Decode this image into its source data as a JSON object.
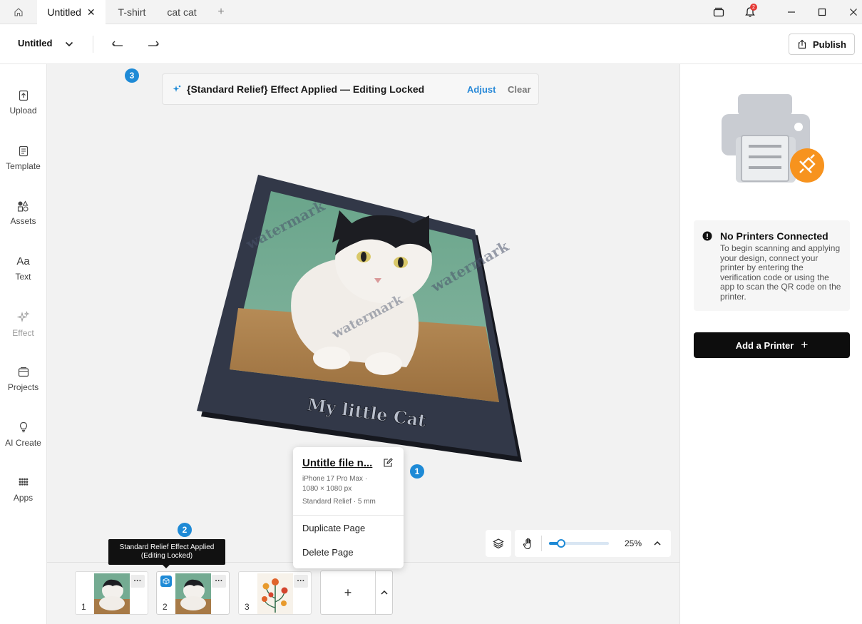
{
  "tabs": [
    {
      "label": "Untitled",
      "close": "✕",
      "active": true
    },
    {
      "label": "T-shirt",
      "active": false
    },
    {
      "label": "cat cat",
      "active": false
    }
  ],
  "titlebar": {
    "new_tab": "+",
    "notification_count": "2"
  },
  "toolbar": {
    "project_name": "Untitled",
    "publish_label": "Publish"
  },
  "sidebar": {
    "items": [
      {
        "label": "Upload",
        "icon": "upload-icon"
      },
      {
        "label": "Template",
        "icon": "template-icon"
      },
      {
        "label": "Assets",
        "icon": "assets-icon"
      },
      {
        "label": "Text",
        "icon": "text-icon",
        "glyph": "Aa"
      },
      {
        "label": "Effect",
        "icon": "sparkle-icon"
      },
      {
        "label": "Projects",
        "icon": "projects-icon"
      },
      {
        "label": "AI Create",
        "icon": "lightbulb-icon"
      },
      {
        "label": "Apps",
        "icon": "apps-grid-icon"
      }
    ]
  },
  "banner": {
    "title": "{Standard Relief} Effect Applied — Editing Locked",
    "adjust": "Adjust",
    "clear": "Clear"
  },
  "steps": {
    "one": "1",
    "two": "2",
    "three": "3"
  },
  "design": {
    "caption": "My little Cat",
    "watermark": "watermark"
  },
  "popup": {
    "file_name": "Untitle file n...",
    "meta1": "iPhone 17 Pro Max ·",
    "meta2": "1080 × 1080 px",
    "meta3": "Standard Relief · 5 mm",
    "duplicate": "Duplicate Page",
    "delete": "Delete Page"
  },
  "zoom": {
    "level": "25%",
    "fraction": 0.2
  },
  "tooltip": {
    "line1": "Standard Relief Effect Applied",
    "line2": "(Editing Locked)"
  },
  "pages": [
    {
      "number": "1",
      "more": "···"
    },
    {
      "number": "2",
      "more": "···"
    },
    {
      "number": "3",
      "more": "···"
    }
  ],
  "add_page": "+",
  "printer": {
    "heading": "No Printers Connected",
    "body": "To begin scanning and applying your design, connect your printer by entering the verification code or using the app to scan the QR code on the printer.",
    "add_label": "Add a Printer",
    "add_plus": "+"
  },
  "colors": {
    "accent": "#1e8ad6",
    "plug_orange": "#f7931e",
    "dark_button": "#0d0d0d"
  }
}
